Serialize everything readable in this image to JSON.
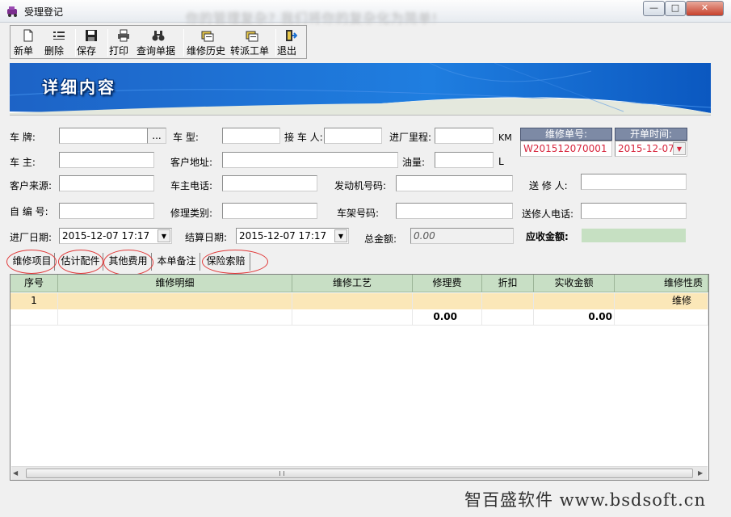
{
  "window": {
    "title": "受理登记",
    "background_text": "你的管理复杂? 我们将你的复杂化为简单!",
    "min_glyph": "—",
    "max_glyph": "□",
    "close_glyph": "✕"
  },
  "toolbar": {
    "items": [
      {
        "label": "新单",
        "icon": "new-document-icon"
      },
      {
        "label": "删除",
        "icon": "delete-list-icon"
      },
      {
        "label": "保存",
        "icon": "save-disk-icon"
      },
      {
        "label": "打印",
        "icon": "printer-icon"
      },
      {
        "label": "查询单据",
        "icon": "binoculars-icon"
      },
      {
        "label": "维修历史",
        "icon": "history-icon"
      },
      {
        "label": "转派工单",
        "icon": "transfer-icon"
      },
      {
        "label": "退出",
        "icon": "exit-door-icon"
      }
    ]
  },
  "banner": {
    "title": "详细内容"
  },
  "form": {
    "plate_label": "车  牌:",
    "plate_value": "",
    "ellipsis": "...",
    "car_type_label": "车  型:",
    "car_type_value": "",
    "receiver_label": "接 车 人:",
    "receiver_value": "",
    "mileage_label": "进厂里程:",
    "mileage_value": "",
    "mileage_unit": "KM",
    "owner_label": "车  主:",
    "owner_value": "",
    "address_label": "客户地址:",
    "address_value": "",
    "fuel_label": "油量:",
    "fuel_value": "",
    "fuel_unit": "L",
    "source_label": "客户来源:",
    "source_value": "",
    "owner_phone_label": "车主电话:",
    "owner_phone_value": "",
    "engine_label": "发动机号码:",
    "engine_value": "",
    "sender_label": "送 修 人:",
    "sender_value": "",
    "code_label": "自 编 号:",
    "code_value": "",
    "repair_type_label": "修理类别:",
    "repair_type_value": "",
    "vin_label": "车架号码:",
    "vin_value": "",
    "sender_phone_label": "送修人电话:",
    "sender_phone_value": "",
    "enter_date_label": "进厂日期:",
    "enter_date_value": "2015-12-07 17:17",
    "settle_date_label": "结算日期:",
    "settle_date_value": "2015-12-07 17:17",
    "total_label": "总金额:",
    "total_value": "0.00",
    "receivable_label": "应收金额:",
    "receivable_value": "",
    "order_no_header": "维修单号:",
    "order_no_value": "W201512070001",
    "open_time_header": "开单时间:",
    "open_time_value": "2015-12-07"
  },
  "tabs": [
    "维修项目",
    "估计配件",
    "其他费用",
    "本单备注",
    "保险索赔"
  ],
  "grid": {
    "columns": [
      "序号",
      "维修明细",
      "维修工艺",
      "修理费",
      "折扣",
      "实收金额",
      "维修性质"
    ],
    "rows": [
      [
        "1",
        "",
        "",
        "",
        "",
        "",
        "维修"
      ]
    ],
    "totals": [
      "",
      "",
      "",
      "0.00",
      "",
      "0.00",
      ""
    ]
  },
  "watermark": "智百盛软件 www.bsdsoft.cn",
  "colors": {
    "accent_blue": "#1a6fd1",
    "order_red": "#d7263d",
    "grid_header": "#c8dfc5",
    "selected_row": "#fbe7b8"
  }
}
